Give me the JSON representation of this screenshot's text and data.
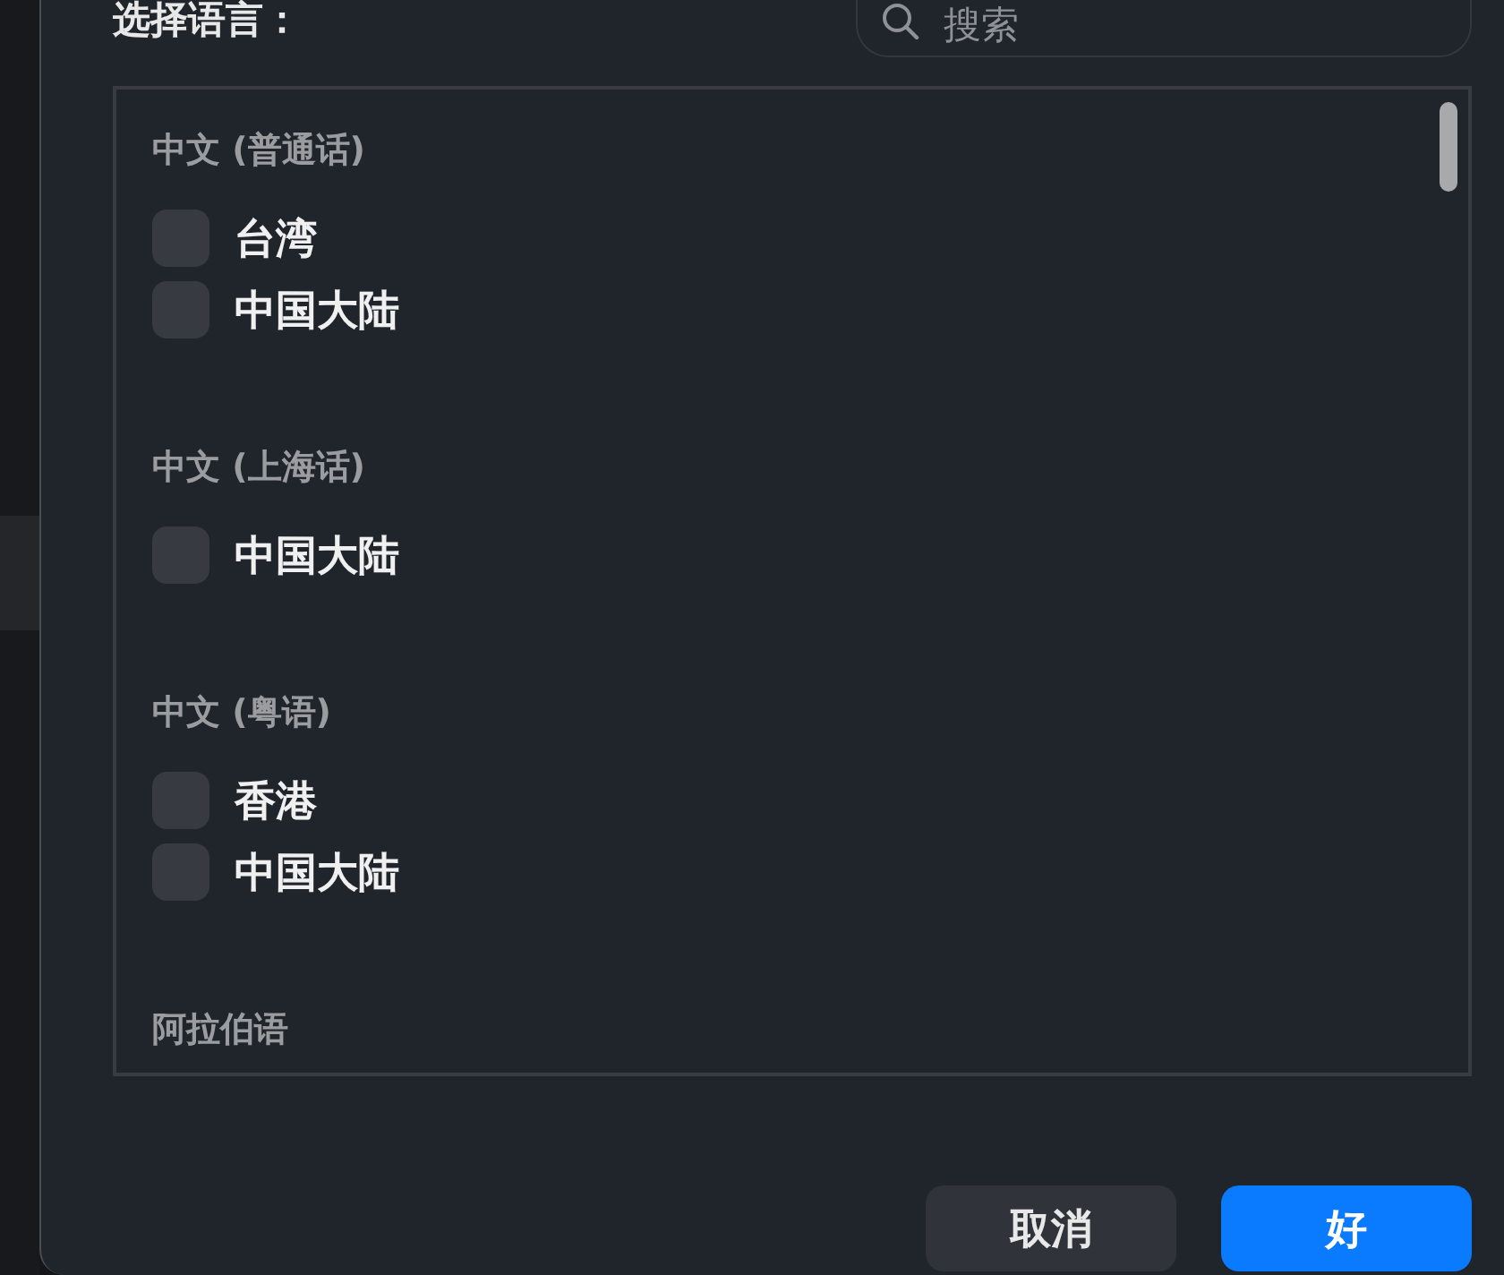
{
  "dialog": {
    "title": "选择语言：",
    "search": {
      "placeholder": "搜索"
    },
    "groups": [
      {
        "name": "中文 (普通话)",
        "items": [
          {
            "label": "台湾",
            "checked": false
          },
          {
            "label": "中国大陆",
            "checked": false
          }
        ]
      },
      {
        "name": "中文 (上海话)",
        "items": [
          {
            "label": "中国大陆",
            "checked": false
          }
        ]
      },
      {
        "name": "中文 (粤语)",
        "items": [
          {
            "label": "香港",
            "checked": false
          },
          {
            "label": "中国大陆",
            "checked": false
          }
        ]
      },
      {
        "name": "阿拉伯语"
      }
    ],
    "buttons": [
      {
        "label": "取消",
        "kind": "secondary"
      },
      {
        "label": "好",
        "kind": "primary"
      }
    ]
  }
}
